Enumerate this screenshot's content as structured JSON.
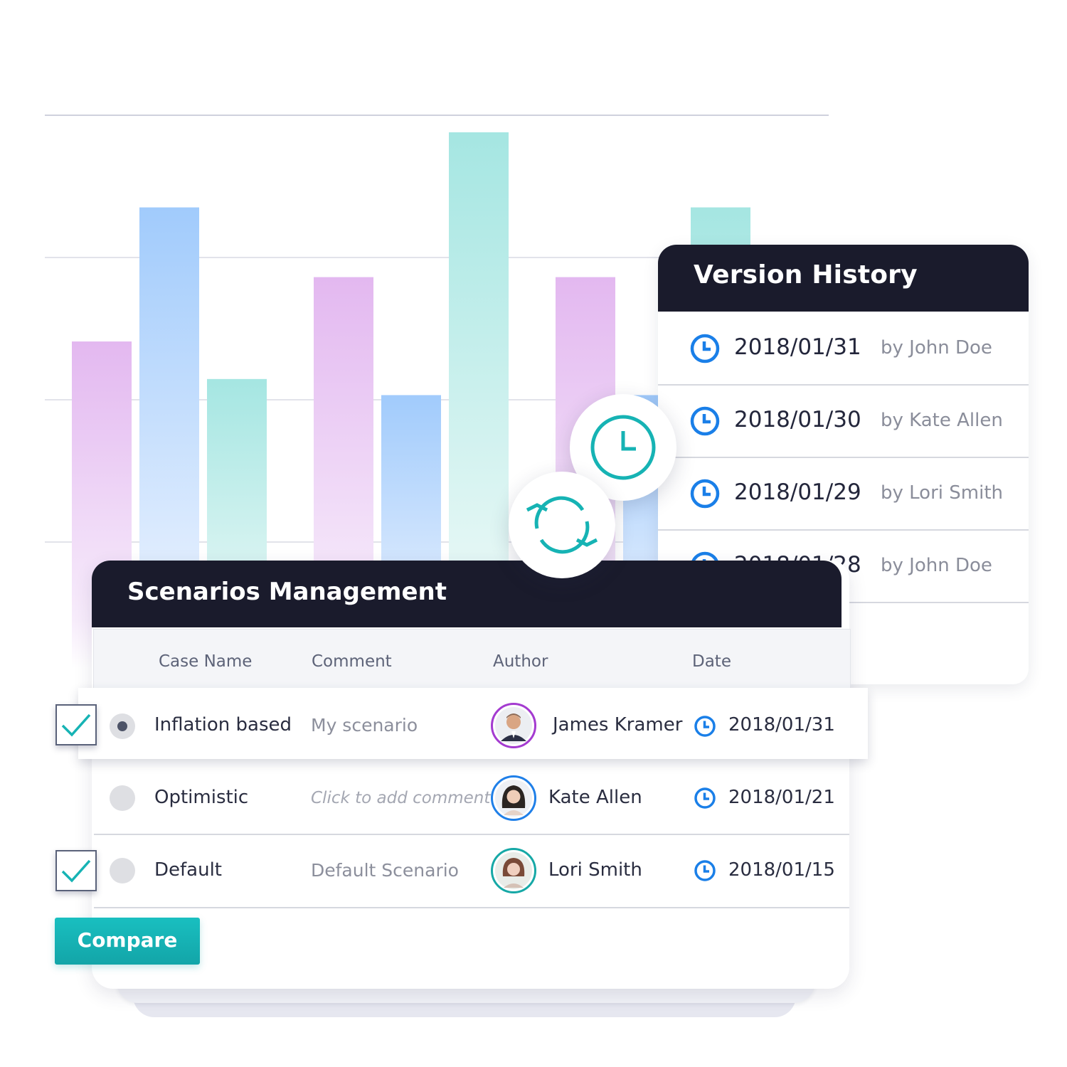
{
  "chart_data": {
    "type": "bar",
    "categories": [
      "",
      "",
      ""
    ],
    "series": [
      {
        "values": [
          61,
          73,
          73
        ]
      },
      {
        "values": [
          86,
          51,
          51
        ]
      },
      {
        "values": [
          54,
          100,
          86
        ]
      }
    ],
    "ylim": [
      0,
      100
    ],
    "grid": true,
    "colors": [
      "#e3b8f0",
      "#a1cbfc",
      "#a5e6e2"
    ]
  },
  "version_history": {
    "title": "Version History",
    "items": [
      {
        "date": "2018/01/31",
        "by": "by John Doe"
      },
      {
        "date": "2018/01/30",
        "by": "by Kate Allen"
      },
      {
        "date": "2018/01/29",
        "by": "by Lori Smith"
      },
      {
        "date": "2018/01/28",
        "by": "by John Doe"
      }
    ]
  },
  "floating": {
    "clock_icon": "clock-icon",
    "sync_icon": "sync-icon"
  },
  "scenarios": {
    "title": "Scenarios Management",
    "columns": {
      "case": "Case Name",
      "comment": "Comment",
      "author": "Author",
      "date": "Date"
    },
    "rows": [
      {
        "case": "Inflation based",
        "comment": "My scenario",
        "author": "James Kramer",
        "date": "2018/01/31",
        "checked": true,
        "radio_selected": true,
        "avatar_ring": "#a43bd0"
      },
      {
        "case": "Optimistic",
        "comment": "Click to add comment",
        "author": "Kate Allen",
        "date": "2018/01/21",
        "checked": false,
        "radio_selected": false,
        "avatar_ring": "#1f7fe8"
      },
      {
        "case": "Default",
        "comment": "Default Scenario",
        "author": "Lori Smith",
        "date": "2018/01/15",
        "checked": true,
        "radio_selected": false,
        "avatar_ring": "#16a8a6"
      }
    ],
    "compare_label": "Compare"
  },
  "colors": {
    "accent_teal": "#16b3b4",
    "clock_blue": "#1a7fe8",
    "header_dark": "#1a1b2c"
  }
}
